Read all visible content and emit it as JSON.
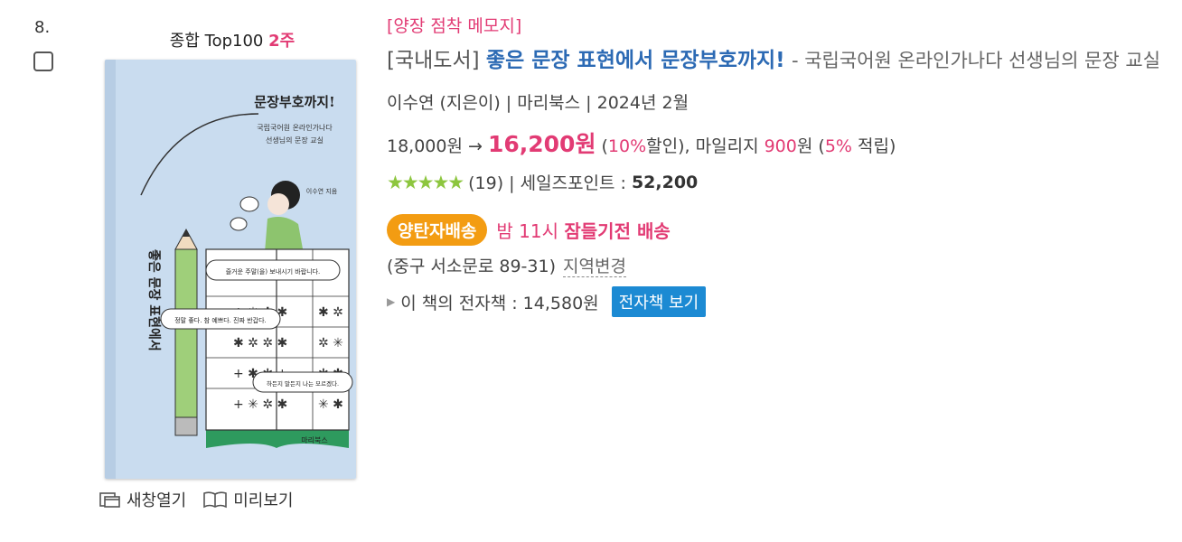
{
  "item": {
    "rank": "8.",
    "rank_label": "종합 Top100",
    "rank_weeks": "2주",
    "tag": "[양장 점착 메모지]",
    "category": "[국내도서]",
    "title": "좋은 문장 표현에서 문장부호까지!",
    "subtitle": "- 국립국어원 온라인가나다 선생님의 문장 교실",
    "authors": "이수연 (지은이) | 마리북스 | 2024년 2월",
    "price": {
      "list": "18,000원 →",
      "sale": "16,200원",
      "discount_open": "(",
      "discount": "10%",
      "discount_close": "할인),",
      "mileage_label": "마일리지",
      "mileage": "900",
      "mileage_unit": "원",
      "mileage_rate_open": "(",
      "mileage_rate": "5%",
      "mileage_rate_close": "적립)"
    },
    "rating": {
      "stars": "★★★★★",
      "count": "(19) | 세일즈포인트 :",
      "points": "52,200"
    },
    "delivery": {
      "badge": "양탄자배송",
      "time": "밤 11시",
      "note": "잠들기전 배송"
    },
    "address": {
      "text": "(중구 서소문로 89-31)",
      "change": "지역변경"
    },
    "ebook": {
      "label": "이 책의 전자책 : 14,580원",
      "button": "전자책 보기"
    },
    "actions": {
      "new_window": "새창열기",
      "preview": "미리보기"
    },
    "cover": {
      "title": "문장부호까지!",
      "subtitle1": "국립국어원 온라인가나다",
      "subtitle2": "선생님의 문장 교실",
      "author": "이수연 지음",
      "spine": "좋은 문장 표현에서",
      "bubble1": "즐거운 주말(을) 보내시기 바랍니다.",
      "bubble2": "정말 좋다. 참 예쁘다. 진짜 반갑다.",
      "bubble3": "하든지 말든지 나는 모르겠다.",
      "publisher": "마리북스"
    }
  },
  "colors": {
    "accent_pink": "#e23b74",
    "title_blue": "#2c6ab4",
    "badge_orange": "#f39c12",
    "ebook_blue": "#1c8ad3",
    "cover_bg": "#c9dcef",
    "cover_green": "#2e9a5e"
  }
}
